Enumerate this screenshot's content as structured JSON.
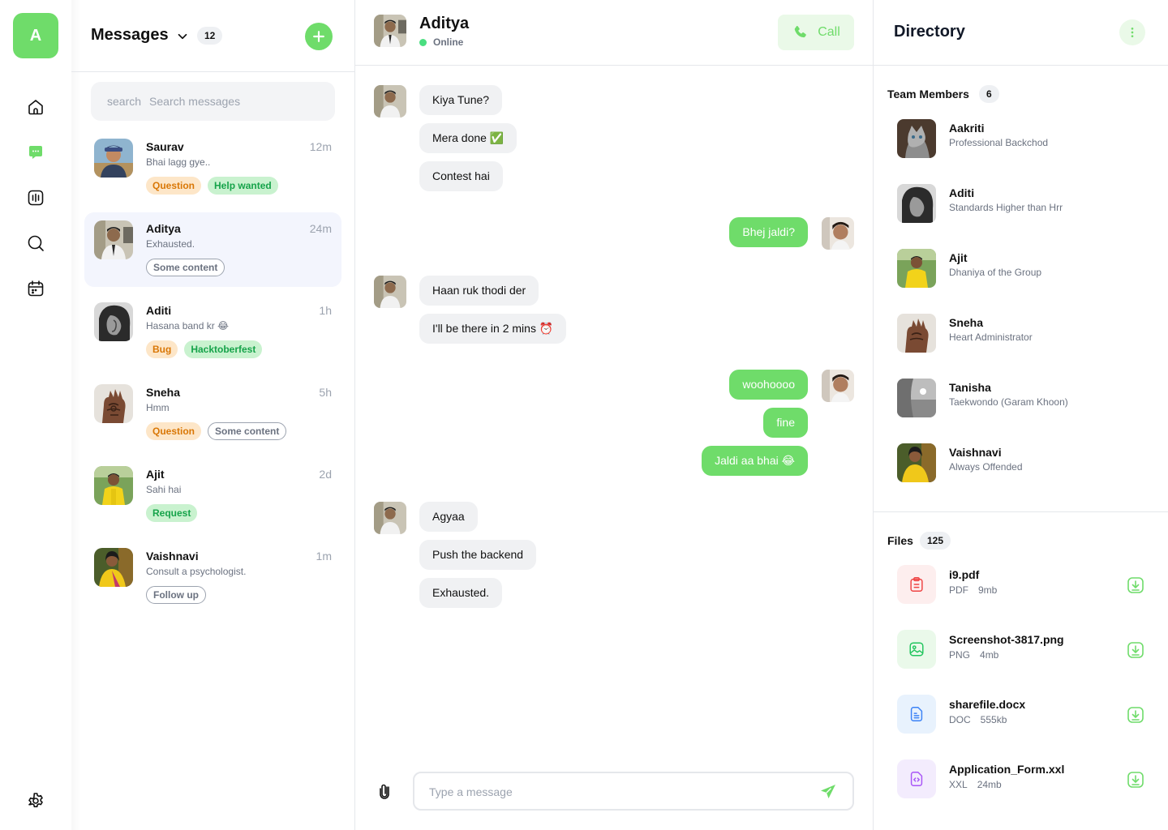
{
  "brand": {
    "letter": "A"
  },
  "colors": {
    "accent": "#6fdc6a",
    "accent_soft": "#eaf9e8",
    "active_row": "#f3f5fd"
  },
  "nav": {
    "items": [
      {
        "icon": "home-icon"
      },
      {
        "icon": "chat-icon",
        "active": true
      },
      {
        "icon": "analytics-icon"
      },
      {
        "icon": "search-icon"
      },
      {
        "icon": "calendar-icon"
      }
    ],
    "settings_icon": "gear-icon"
  },
  "messages": {
    "title": "Messages",
    "count": "12",
    "search_icon_label": "search",
    "search_placeholder": "Search messages",
    "conversations": [
      {
        "name": "Saurav",
        "time": "12m",
        "preview": "Bhai lagg gye..",
        "tags": [
          {
            "label": "Question",
            "style": "orange"
          },
          {
            "label": "Help wanted",
            "style": "green"
          }
        ]
      },
      {
        "name": "Aditya",
        "time": "24m",
        "preview": "Exhausted.",
        "tags": [
          {
            "label": "Some content",
            "style": "outline"
          }
        ],
        "active": true
      },
      {
        "name": "Aditi",
        "time": "1h",
        "preview": "Hasana band kr 😂",
        "tags": [
          {
            "label": "Bug",
            "style": "orange"
          },
          {
            "label": "Hacktoberfest",
            "style": "green"
          }
        ]
      },
      {
        "name": "Sneha",
        "time": "5h",
        "preview": "Hmm",
        "tags": [
          {
            "label": "Question",
            "style": "orange"
          },
          {
            "label": "Some content",
            "style": "outline"
          }
        ]
      },
      {
        "name": "Ajit",
        "time": "2d",
        "preview": "Sahi hai",
        "tags": [
          {
            "label": "Request",
            "style": "green"
          }
        ]
      },
      {
        "name": "Vaishnavi",
        "time": "1m",
        "preview": "Consult a psychologist.",
        "tags": [
          {
            "label": "Follow up",
            "style": "outline"
          }
        ]
      }
    ]
  },
  "chat": {
    "name": "Aditya",
    "status": "Online",
    "call_label": "Call",
    "messages": [
      {
        "from": "them",
        "text": "Kiya Tune?"
      },
      {
        "from": "them",
        "text": "Mera done ✅"
      },
      {
        "from": "them",
        "text": "Contest hai"
      },
      {
        "from": "me",
        "text": "Bhej jaldi?"
      },
      {
        "from": "them",
        "text": "Haan ruk thodi der"
      },
      {
        "from": "them",
        "text": "I'll be there in 2 mins ⏰"
      },
      {
        "from": "me",
        "text": "woohoooo"
      },
      {
        "from": "me",
        "text": "fine"
      },
      {
        "from": "me",
        "text": "Jaldi aa bhai 😂"
      },
      {
        "from": "them",
        "text": "Agyaa"
      },
      {
        "from": "them",
        "text": "Push the backend"
      },
      {
        "from": "them",
        "text": "Exhausted."
      }
    ],
    "composer_placeholder": "Type a message"
  },
  "directory": {
    "title": "Directory",
    "team_label": "Team Members",
    "team_count": "6",
    "members": [
      {
        "name": "Aakriti",
        "role": "Professional Backchod"
      },
      {
        "name": "Aditi",
        "role": "Standards Higher than Hrr"
      },
      {
        "name": "Ajit",
        "role": "Dhaniya of the Group"
      },
      {
        "name": "Sneha",
        "role": "Heart Administrator"
      },
      {
        "name": "Tanisha",
        "role": "Taekwondo (Garam Khoon)"
      },
      {
        "name": "Vaishnavi",
        "role": "Always Offended"
      }
    ],
    "files_label": "Files",
    "files_count": "125",
    "files": [
      {
        "name": "i9.pdf",
        "type": "PDF",
        "size": "9mb",
        "icon": "pdf-file-icon",
        "color": "#ef4444",
        "bg": "#fdeeee"
      },
      {
        "name": "Screenshot-3817.png",
        "type": "PNG",
        "size": "4mb",
        "icon": "image-file-icon",
        "color": "#22c55e",
        "bg": "#eaf9ea"
      },
      {
        "name": "sharefile.docx",
        "type": "DOC",
        "size": "555kb",
        "icon": "doc-file-icon",
        "color": "#3b82f6",
        "bg": "#e8f2fd"
      },
      {
        "name": "Application_Form.xxl",
        "type": "XXL",
        "size": "24mb",
        "icon": "code-file-icon",
        "color": "#a855f7",
        "bg": "#f3ecfd"
      }
    ]
  }
}
